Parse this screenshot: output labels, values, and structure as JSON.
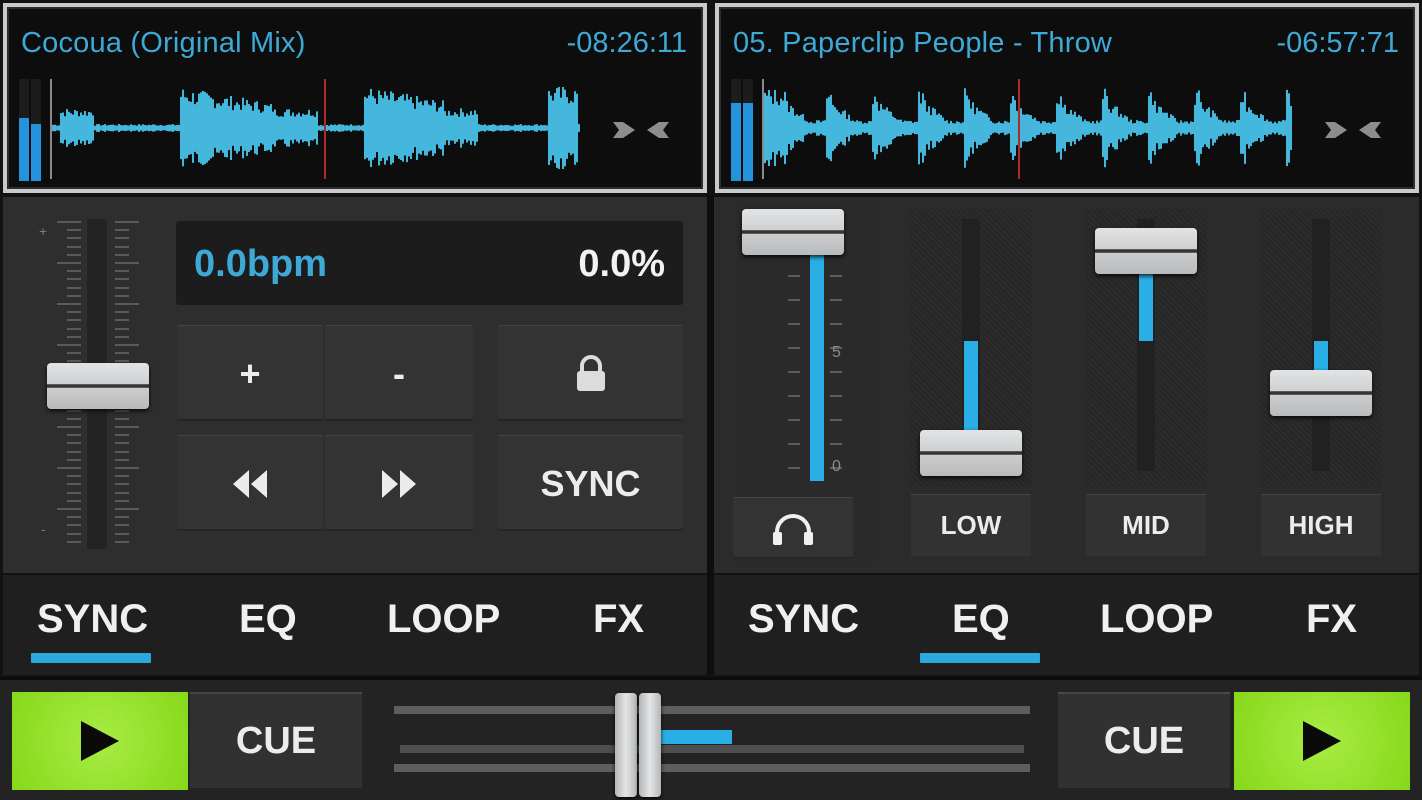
{
  "deck_a": {
    "track_title": "Cocoua (Original Mix)",
    "time_remaining": "-08:26:11",
    "vu_levels": [
      0.62,
      0.56
    ],
    "pitch_fader": {
      "top_label": "+",
      "bottom_label": "-",
      "value_fraction": 0.5
    },
    "bpm": "0.0bpm",
    "pitch_percent": "0.0%",
    "buttons": {
      "pitch_plus": "+",
      "pitch_minus": "-",
      "sync": "SYNC"
    },
    "tabs": [
      {
        "label": "SYNC",
        "active": true
      },
      {
        "label": "EQ",
        "active": false
      },
      {
        "label": "LOOP",
        "active": false
      },
      {
        "label": "FX",
        "active": false
      }
    ],
    "cue_label": "CUE"
  },
  "deck_b": {
    "track_title": "05. Paperclip People - Throw",
    "time_remaining": "-06:57:71",
    "vu_levels": [
      0.76,
      0.76
    ],
    "volume": {
      "value_fraction": 1.0,
      "label_mid": "5",
      "label_low": "0"
    },
    "eq": [
      {
        "label": "LOW",
        "value_fraction": 0.13
      },
      {
        "label": "MID",
        "value_fraction": 0.78
      },
      {
        "label": "HIGH",
        "value_fraction": 0.38
      }
    ],
    "tabs": [
      {
        "label": "SYNC",
        "active": false
      },
      {
        "label": "EQ",
        "active": true
      },
      {
        "label": "LOOP",
        "active": false
      },
      {
        "label": "FX",
        "active": false
      }
    ],
    "cue_label": "CUE"
  },
  "crossfader": {
    "value_fraction": 0.38
  },
  "colors": {
    "accent_blue": "#29aee5",
    "text_blue": "#3ea9d6",
    "play_green": "#95e22c",
    "playhead_red": "#b02a2a"
  },
  "icons": {
    "headphones": "headphones-icon",
    "lock": "lock-icon",
    "rewind": "rewind-icon",
    "fast_forward": "fast-forward-icon",
    "play": "play-icon",
    "nudge": "nudge-arrows-icon"
  }
}
